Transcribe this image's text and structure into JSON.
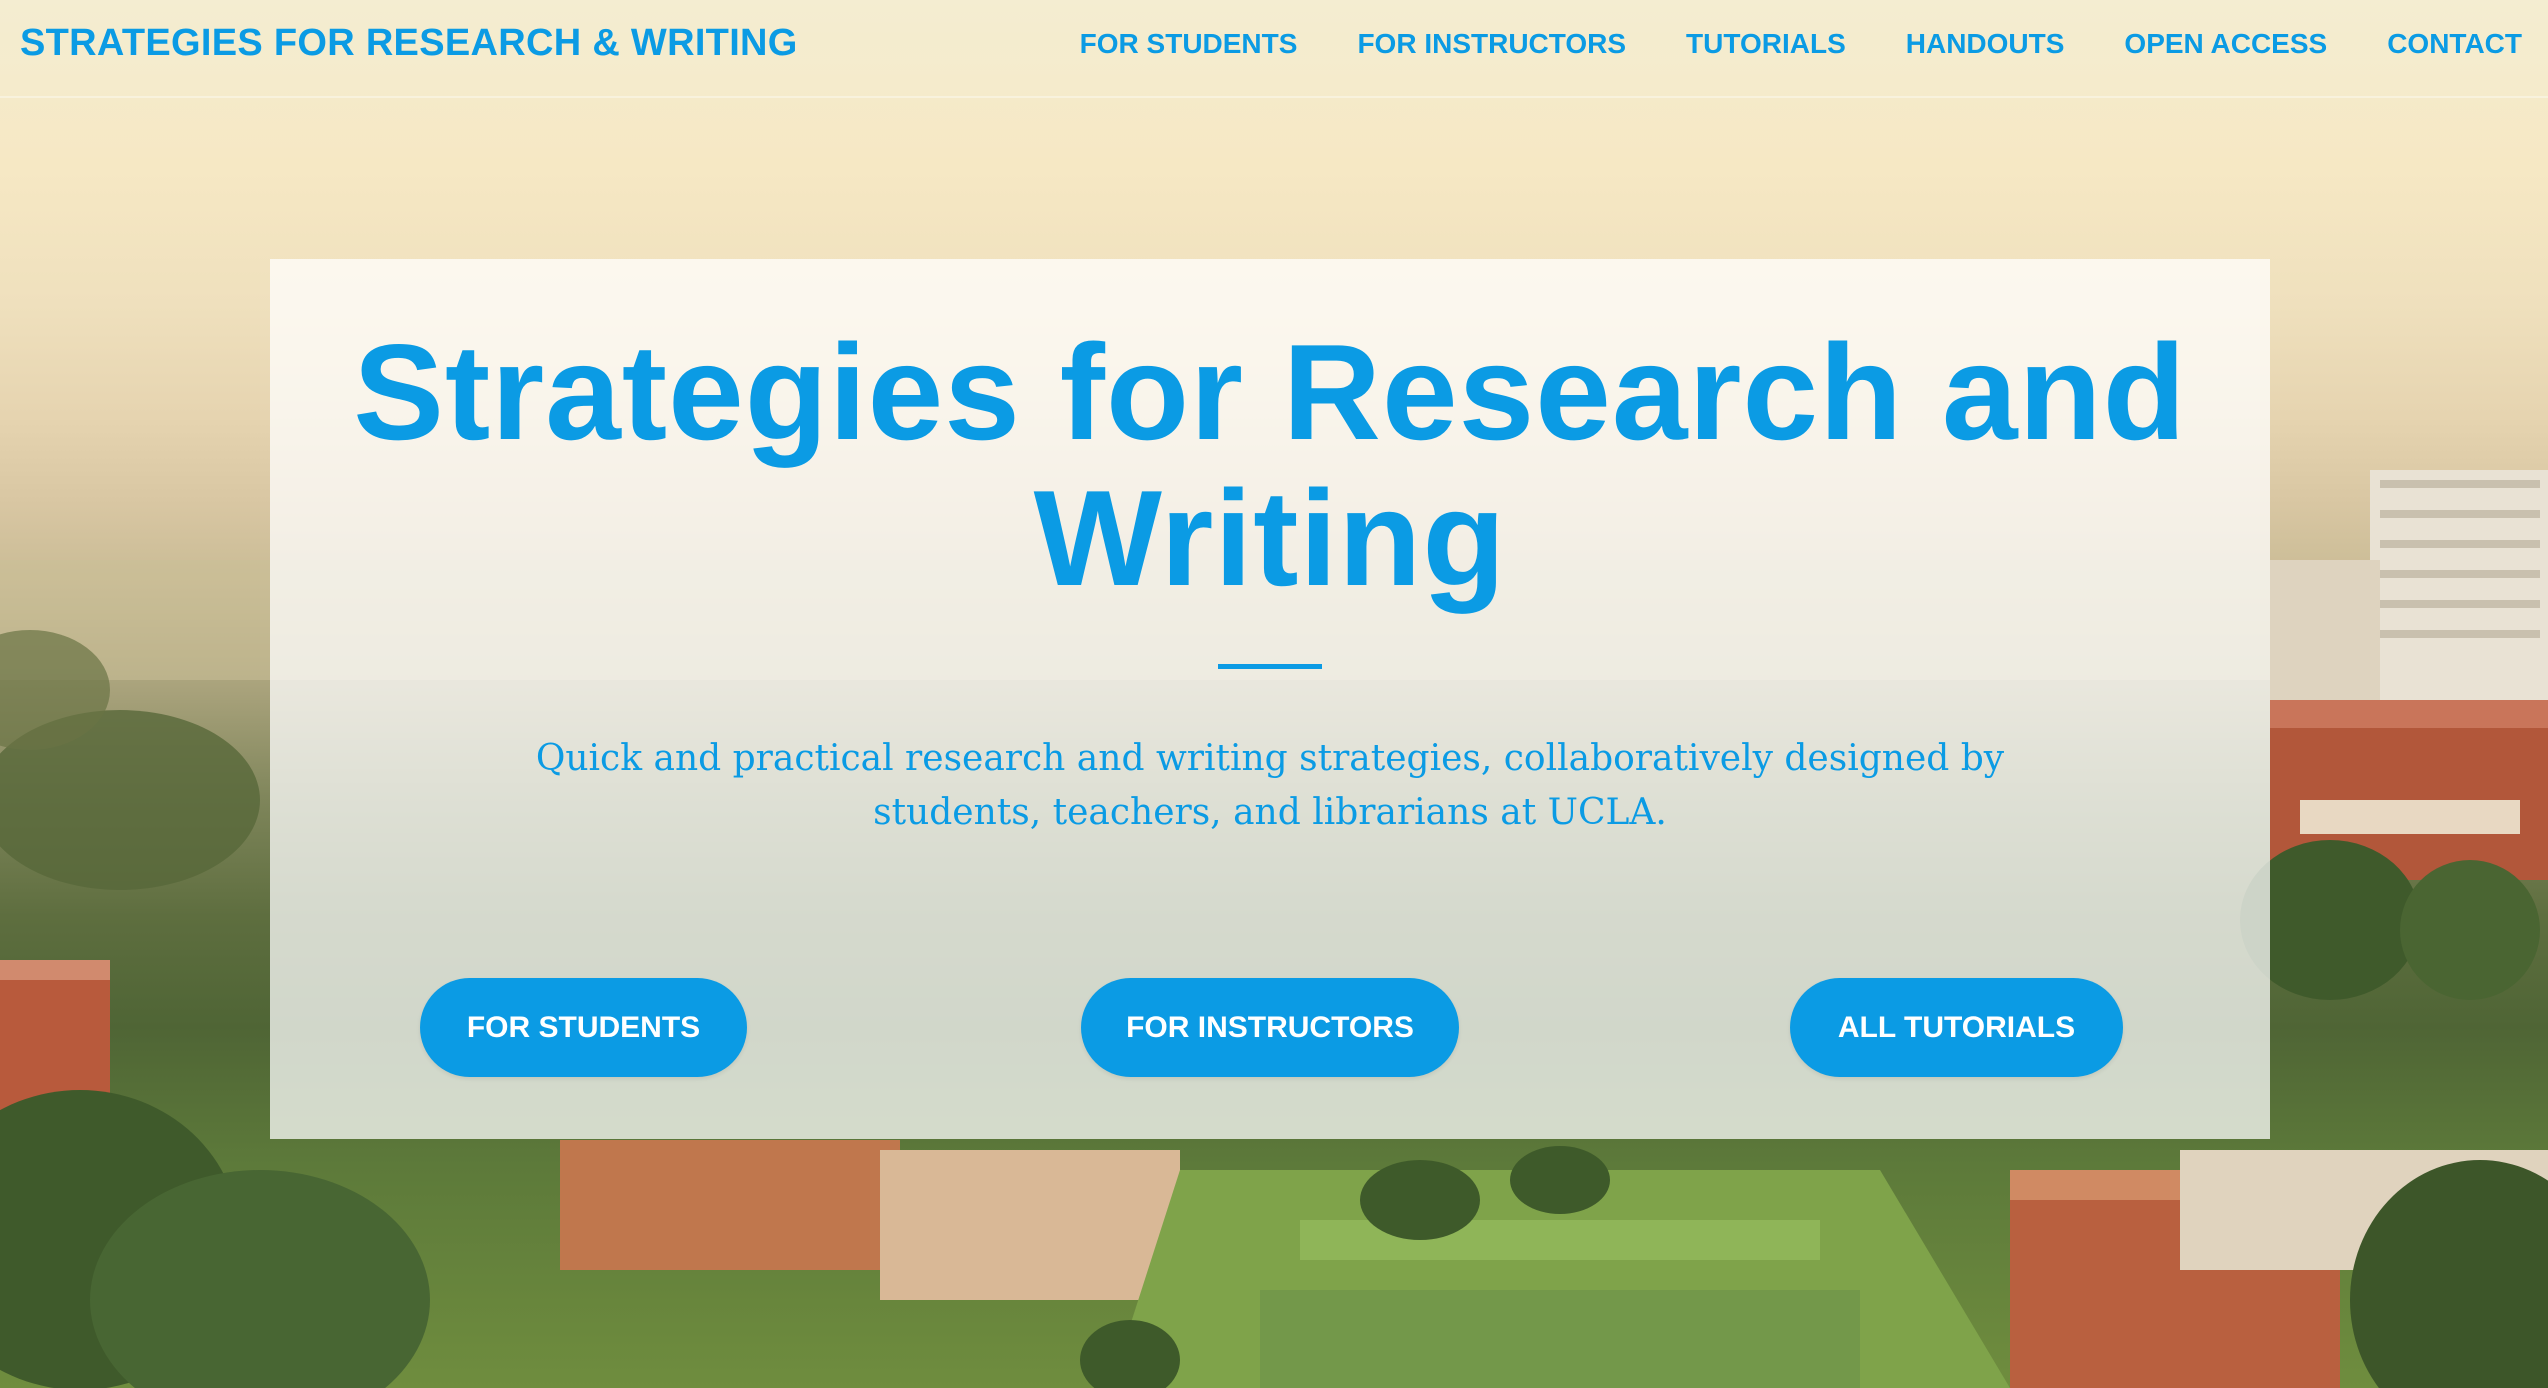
{
  "site": {
    "brand": "STRATEGIES FOR RESEARCH & WRITING"
  },
  "nav": {
    "items": [
      {
        "label": "FOR STUDENTS"
      },
      {
        "label": "FOR INSTRUCTORS"
      },
      {
        "label": "TUTORIALS"
      },
      {
        "label": "HANDOUTS"
      },
      {
        "label": "OPEN ACCESS"
      },
      {
        "label": "CONTACT"
      }
    ]
  },
  "hero": {
    "title": "Strategies for Research and Writing",
    "subtitle": "Quick and practical research and writing strategies, collaboratively designed by students, teachers, and librarians at UCLA.",
    "buttons": [
      {
        "label": "FOR STUDENTS"
      },
      {
        "label": "FOR INSTRUCTORS"
      },
      {
        "label": "ALL TUTORIALS"
      }
    ]
  },
  "colors": {
    "accent": "#0b9be4",
    "button_text": "#ffffff",
    "card_bg": "rgba(255,255,255,0.74)"
  }
}
